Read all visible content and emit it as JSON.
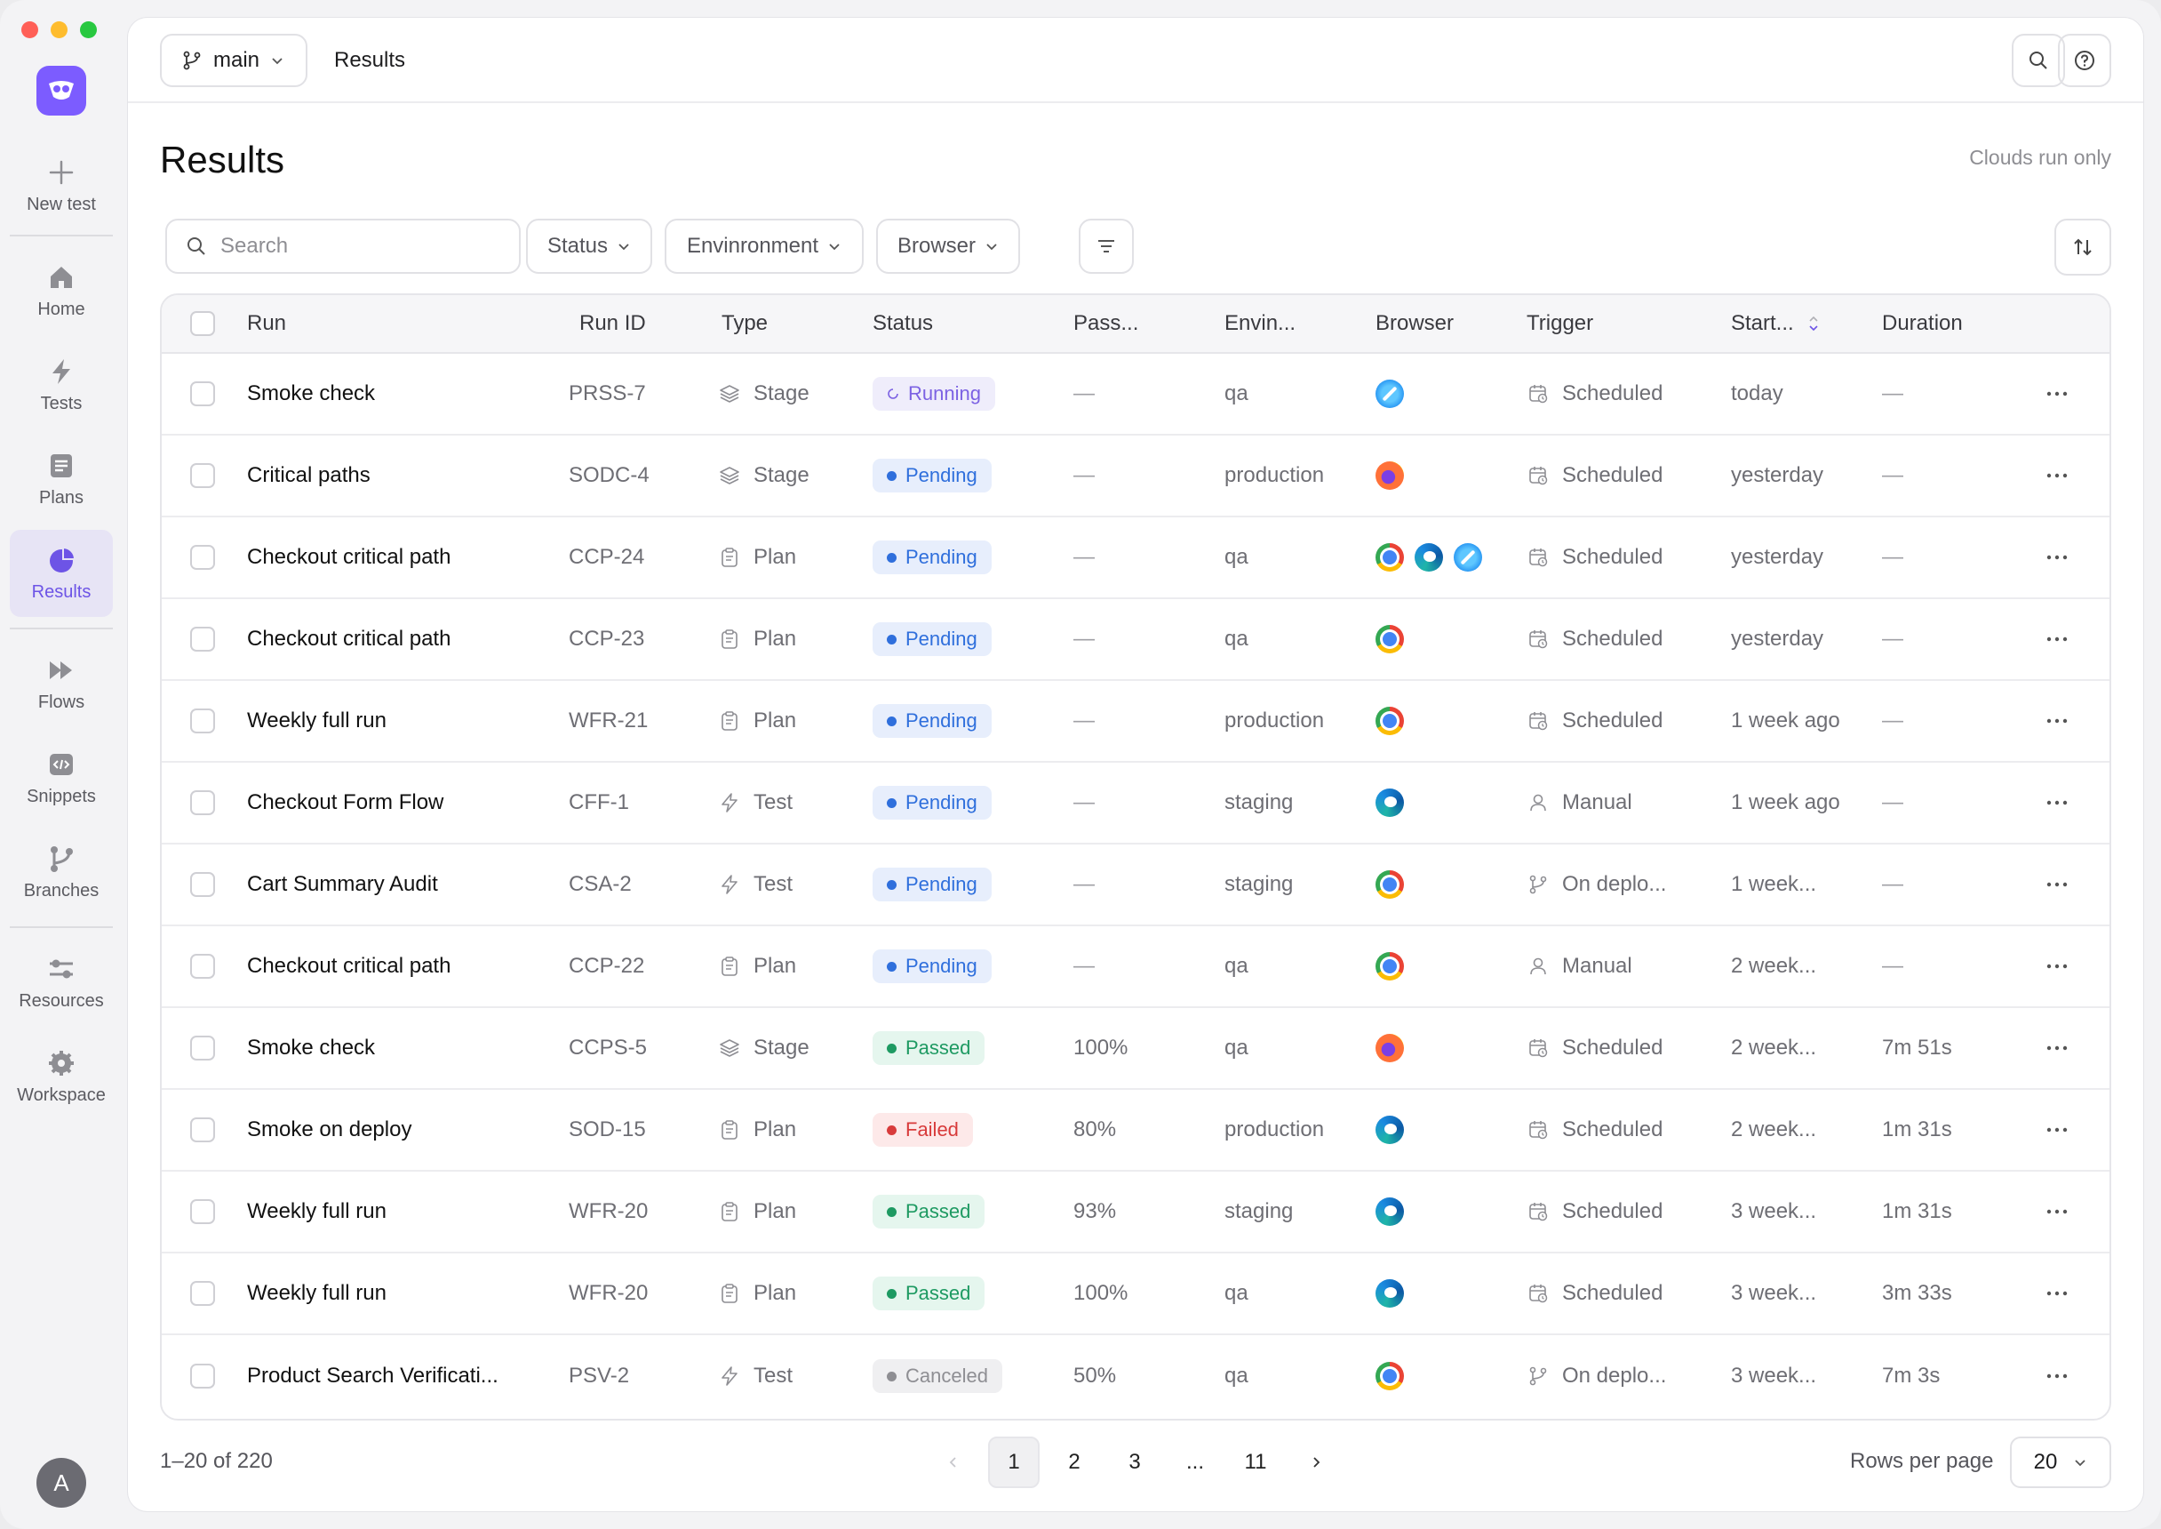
{
  "sidebar": {
    "new_test": "New test",
    "items": [
      {
        "label": "Home",
        "icon": "home-icon"
      },
      {
        "label": "Tests",
        "icon": "bolt-icon"
      },
      {
        "label": "Plans",
        "icon": "plan-icon"
      },
      {
        "label": "Results",
        "icon": "pie-chart-icon",
        "active": true
      },
      {
        "label": "Flows",
        "icon": "flows-icon"
      },
      {
        "label": "Snippets",
        "icon": "code-icon"
      },
      {
        "label": "Branches",
        "icon": "branch-icon"
      },
      {
        "label": "Resources",
        "icon": "sliders-icon"
      },
      {
        "label": "Workspace",
        "icon": "gear-icon"
      }
    ],
    "avatar": "A"
  },
  "topbar": {
    "branch": "main",
    "breadcrumb": "Results"
  },
  "page": {
    "title": "Results",
    "clouds_toggle": "Clouds run only"
  },
  "filters": {
    "search_placeholder": "Search",
    "status": "Status",
    "environment": "Envinronment",
    "browser": "Browser"
  },
  "table": {
    "columns": [
      "Run",
      "Run ID",
      "Type",
      "Status",
      "Pass...",
      "Envin...",
      "Browser",
      "Trigger",
      "Start...",
      "Duration"
    ],
    "rows": [
      {
        "run": "Smoke check",
        "id": "PRSS-7",
        "type": "Stage",
        "status": "Running",
        "pass": "—",
        "env": "qa",
        "browsers": [
          "safari"
        ],
        "trigger": "Scheduled",
        "trigger_icon": "calendar",
        "start": "today",
        "duration": "—"
      },
      {
        "run": "Critical paths",
        "id": "SODC-4",
        "type": "Stage",
        "status": "Pending",
        "pass": "—",
        "env": "production",
        "browsers": [
          "firefox"
        ],
        "trigger": "Scheduled",
        "trigger_icon": "calendar",
        "start": "yesterday",
        "duration": "—"
      },
      {
        "run": "Checkout critical path",
        "id": "CCP-24",
        "type": "Plan",
        "status": "Pending",
        "pass": "—",
        "env": "qa",
        "browsers": [
          "chrome",
          "edge",
          "safari"
        ],
        "trigger": "Scheduled",
        "trigger_icon": "calendar",
        "start": "yesterday",
        "duration": "—"
      },
      {
        "run": "Checkout critical path",
        "id": "CCP-23",
        "type": "Plan",
        "status": "Pending",
        "pass": "—",
        "env": "qa",
        "browsers": [
          "chrome"
        ],
        "trigger": "Scheduled",
        "trigger_icon": "calendar",
        "start": "yesterday",
        "duration": "—"
      },
      {
        "run": "Weekly full run",
        "id": "WFR-21",
        "type": "Plan",
        "status": "Pending",
        "pass": "—",
        "env": "production",
        "browsers": [
          "chrome"
        ],
        "trigger": "Scheduled",
        "trigger_icon": "calendar",
        "start": "1 week ago",
        "duration": "—"
      },
      {
        "run": "Checkout Form Flow",
        "id": "CFF-1",
        "type": "Test",
        "status": "Pending",
        "pass": "—",
        "env": "staging",
        "browsers": [
          "edge"
        ],
        "trigger": "Manual",
        "trigger_icon": "user",
        "start": "1 week ago",
        "duration": "—"
      },
      {
        "run": "Cart Summary Audit",
        "id": "CSA-2",
        "type": "Test",
        "status": "Pending",
        "pass": "—",
        "env": "staging",
        "browsers": [
          "chrome"
        ],
        "trigger": "On deplo...",
        "trigger_icon": "branch",
        "start": "1 week...",
        "duration": "—"
      },
      {
        "run": "Checkout critical path",
        "id": "CCP-22",
        "type": "Plan",
        "status": "Pending",
        "pass": "—",
        "env": "qa",
        "browsers": [
          "chrome"
        ],
        "trigger": "Manual",
        "trigger_icon": "user",
        "start": "2 week...",
        "duration": "—"
      },
      {
        "run": "Smoke check",
        "id": "CCPS-5",
        "type": "Stage",
        "status": "Passed",
        "pass": "100%",
        "env": "qa",
        "browsers": [
          "firefox"
        ],
        "trigger": "Scheduled",
        "trigger_icon": "calendar",
        "start": "2 week...",
        "duration": "7m 51s"
      },
      {
        "run": "Smoke on deploy",
        "id": "SOD-15",
        "type": "Plan",
        "status": "Failed",
        "pass": "80%",
        "env": "production",
        "browsers": [
          "edge"
        ],
        "trigger": "Scheduled",
        "trigger_icon": "calendar",
        "start": "2 week...",
        "duration": "1m 31s"
      },
      {
        "run": "Weekly full run",
        "id": "WFR-20",
        "type": "Plan",
        "status": "Passed",
        "pass": "93%",
        "env": "staging",
        "browsers": [
          "edge"
        ],
        "trigger": "Scheduled",
        "trigger_icon": "calendar",
        "start": "3 week...",
        "duration": "1m 31s"
      },
      {
        "run": "Weekly full run",
        "id": "WFR-20",
        "type": "Plan",
        "status": "Passed",
        "pass": "100%",
        "env": "qa",
        "browsers": [
          "edge"
        ],
        "trigger": "Scheduled",
        "trigger_icon": "calendar",
        "start": "3 week...",
        "duration": "3m 33s"
      },
      {
        "run": "Product Search Verificati...",
        "id": "PSV-2",
        "type": "Test",
        "status": "Canceled",
        "pass": "50%",
        "env": "qa",
        "browsers": [
          "chrome"
        ],
        "trigger": "On deplo...",
        "trigger_icon": "branch",
        "start": "3 week...",
        "duration": "7m 3s"
      }
    ]
  },
  "footer": {
    "range": "1–20 of 220",
    "pages": [
      "1",
      "2",
      "3",
      "...",
      "11"
    ],
    "current_page": "1",
    "rows_per_page_label": "Rows per page",
    "rows_per_page": "20"
  },
  "colors": {
    "accent": "#6d54e6",
    "running": "#7c62e3",
    "pending": "#2f6fdc",
    "passed": "#1e9a62",
    "failed": "#d83b3b",
    "canceled": "#8e8e93"
  }
}
